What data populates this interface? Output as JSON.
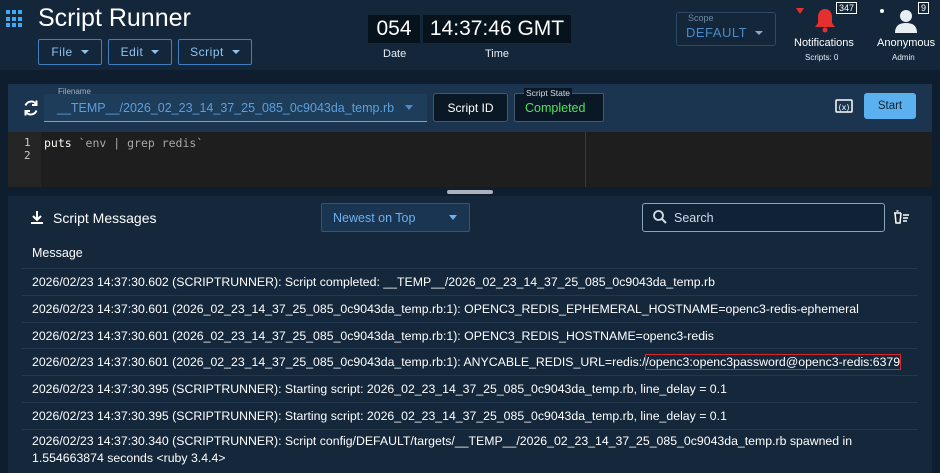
{
  "app": {
    "title": "Script Runner"
  },
  "menu": {
    "file": "File",
    "edit": "Edit",
    "script": "Script"
  },
  "clock": {
    "date_value": "054",
    "date_label": "Date",
    "time_value": "14:37:46 GMT",
    "time_label": "Time"
  },
  "scope": {
    "label": "Scope",
    "value": "DEFAULT"
  },
  "notifications": {
    "count": "347",
    "label": "Notifications",
    "sub": "Scripts: 0"
  },
  "user": {
    "count": "9",
    "name": "Anonymous",
    "role": "Admin"
  },
  "scriptbar": {
    "filename_label": "Filename",
    "filename_value": "__TEMP__/2026_02_23_14_37_25_085_0c9043da_temp.rb",
    "script_id_button": "Script ID",
    "state_label": "Script State",
    "state_value": "Completed",
    "start_button": "Start"
  },
  "editor": {
    "line_numbers": [
      "1",
      "2"
    ],
    "code_keyword": "puts",
    "code_string": " `env | grep redis`"
  },
  "messages": {
    "title": "Script Messages",
    "sort_value": "Newest on Top",
    "search_placeholder": "Search",
    "column_header": "Message",
    "rows": [
      "2026/02/23 14:37:30.602 (SCRIPTRUNNER): Script completed: __TEMP__/2026_02_23_14_37_25_085_0c9043da_temp.rb",
      "2026/02/23 14:37:30.601 (2026_02_23_14_37_25_085_0c9043da_temp.rb:1): OPENC3_REDIS_EPHEMERAL_HOSTNAME=openc3-redis-ephemeral",
      "2026/02/23 14:37:30.601 (2026_02_23_14_37_25_085_0c9043da_temp.rb:1): OPENC3_REDIS_HOSTNAME=openc3-redis",
      "2026/02/23 14:37:30.395 (SCRIPTRUNNER): Starting script: 2026_02_23_14_37_25_085_0c9043da_temp.rb, line_delay = 0.1",
      "2026/02/23 14:37:30.395 (SCRIPTRUNNER): Starting script: 2026_02_23_14_37_25_085_0c9043da_temp.rb, line_delay = 0.1",
      "2026/02/23 14:37:30.340 (SCRIPTRUNNER): Script config/DEFAULT/targets/__TEMP__/2026_02_23_14_37_25_085_0c9043da_temp.rb spawned in 1.554663874 seconds <ruby 3.4.4>"
    ],
    "anycable_prefix": "2026/02/23 14:37:30.601 (2026_02_23_14_37_25_085_0c9043da_temp.rb:1): ANYCABLE_REDIS_URL=redis:/",
    "anycable_highlight": "/openc3:openc3password@openc3-redis:6379"
  },
  "colors": {
    "accent": "#5bb1ef",
    "success": "#4fe35e",
    "alert": "#e53030",
    "highlight_border": "#d6262a"
  }
}
